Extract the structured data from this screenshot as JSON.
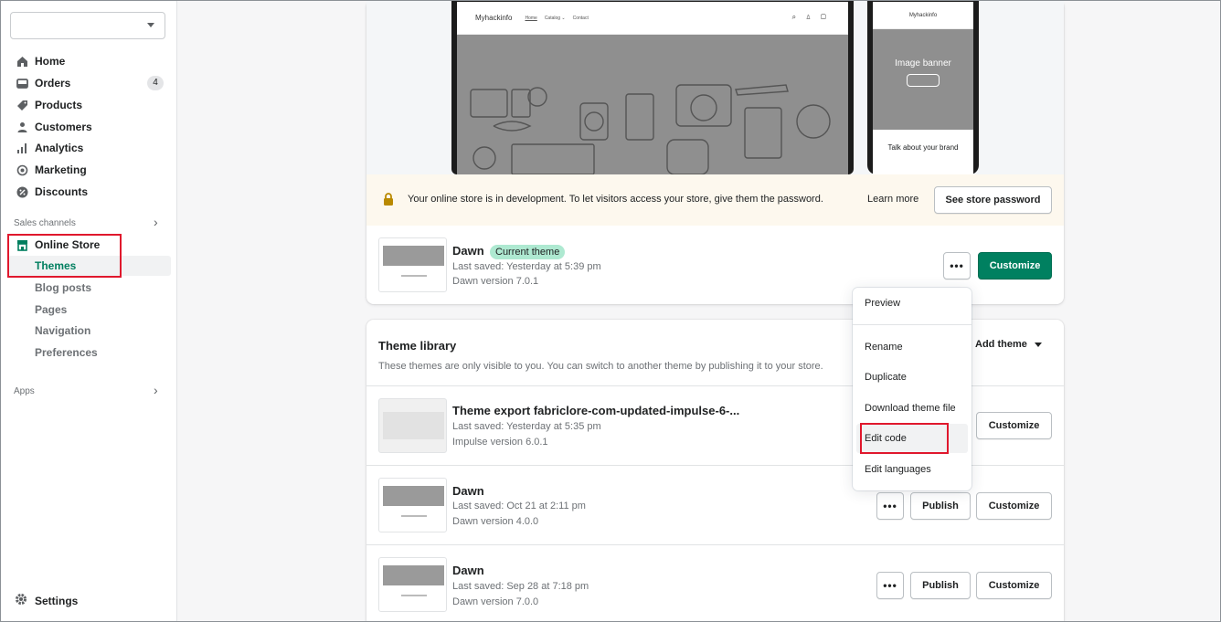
{
  "sidebar": {
    "store_selector_value": "",
    "items": [
      {
        "label": "Home",
        "icon": "home-icon"
      },
      {
        "label": "Orders",
        "icon": "orders-icon",
        "badge": "4"
      },
      {
        "label": "Products",
        "icon": "products-tag-icon"
      },
      {
        "label": "Customers",
        "icon": "customers-person-icon"
      },
      {
        "label": "Analytics",
        "icon": "analytics-bars-icon"
      },
      {
        "label": "Marketing",
        "icon": "marketing-target-icon"
      },
      {
        "label": "Discounts",
        "icon": "discounts-icon"
      }
    ],
    "sales_channels_label": "Sales channels",
    "online_store": {
      "label": "Online Store",
      "icon": "store-icon",
      "sub_items": [
        "Themes",
        "Blog posts",
        "Pages",
        "Navigation",
        "Preferences"
      ],
      "active": "Themes"
    },
    "apps_label": "Apps",
    "settings_label": "Settings"
  },
  "preview": {
    "desktop": {
      "logo": "Myhackinfo",
      "nav": [
        "Home",
        "Catalog ⌄",
        "Contact"
      ]
    },
    "mobile": {
      "logo": "Myhackinfo",
      "banner_title": "Image banner",
      "talk_title": "Talk about your brand"
    }
  },
  "dev_banner": {
    "text": "Your online store is in development. To let visitors access your store, give them the password.",
    "learn_more": "Learn more",
    "button": "See store password",
    "accent_color": "#b98900"
  },
  "current_theme": {
    "name": "Dawn",
    "badge": "Current theme",
    "last_saved": "Last saved: Yesterday at 5:39 pm",
    "version": "Dawn version 7.0.1",
    "more_label": "•••",
    "customize_label": "Customize"
  },
  "dropdown": {
    "items": [
      "Preview",
      "Rename",
      "Duplicate",
      "Download theme file",
      "Edit code",
      "Edit languages"
    ]
  },
  "library": {
    "title": "Theme library",
    "description": "These themes are only visible to you. You can switch to another theme by publishing it to your store.",
    "add_theme_label": "Add theme",
    "themes": [
      {
        "name": "Theme export fabriclore-com-updated-impulse-6-...",
        "last_saved": "Last saved: Yesterday at 5:35 pm",
        "version": "Impulse version 6.0.1",
        "customize_label": "Customize"
      },
      {
        "name": "Dawn",
        "last_saved": "Last saved: Oct 21 at 2:11 pm",
        "version": "Dawn version 4.0.0",
        "more_label": "•••",
        "publish_label": "Publish",
        "customize_label": "Customize"
      },
      {
        "name": "Dawn",
        "last_saved": "Last saved: Sep 28 at 7:18 pm",
        "version": "Dawn version 7.0.0",
        "more_label": "•••",
        "publish_label": "Publish",
        "customize_label": "Customize"
      }
    ]
  },
  "colors": {
    "brand_green": "#008060",
    "active_green": "#007f5f",
    "highlight_red": "#e0182d"
  }
}
